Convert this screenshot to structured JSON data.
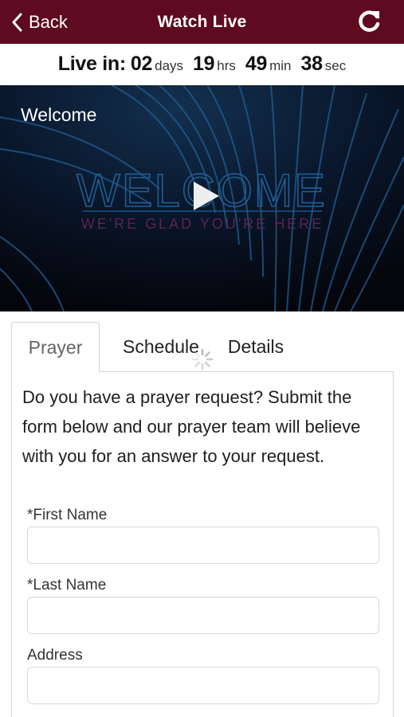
{
  "header": {
    "back_label": "Back",
    "title": "Watch Live",
    "background": "#5e0b1f"
  },
  "countdown": {
    "label": "Live in:",
    "days": "02",
    "days_unit": "days",
    "hours": "19",
    "hours_unit": "hrs",
    "minutes": "49",
    "minutes_unit": "min",
    "seconds": "38",
    "seconds_unit": "sec"
  },
  "video": {
    "label": "Welcome",
    "thumbnail_title": "WELCOME",
    "thumbnail_subtitle": "WE'RE GLAD YOU'RE HERE"
  },
  "tabs": [
    {
      "label": "Prayer",
      "active": true
    },
    {
      "label": "Schedule",
      "active": false
    },
    {
      "label": "Details",
      "active": false
    }
  ],
  "prayer": {
    "intro": "Do you have a prayer request? Submit the form below and our prayer team will believe with you for an answer to your request.",
    "fields": [
      {
        "label": "*First Name",
        "value": ""
      },
      {
        "label": "*Last Name",
        "value": ""
      },
      {
        "label": "Address",
        "value": ""
      }
    ]
  }
}
